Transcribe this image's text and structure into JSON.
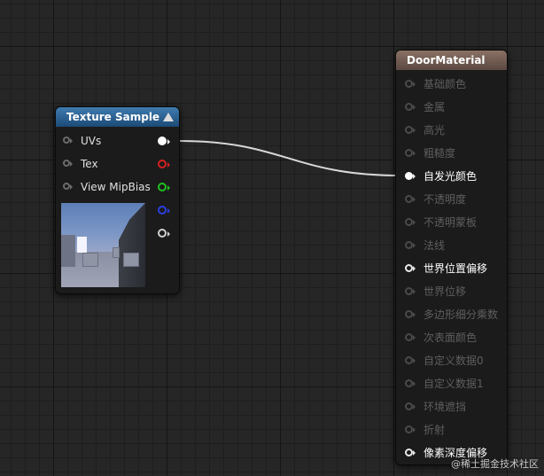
{
  "texture_node": {
    "title": "Texture Sample",
    "inputs": [
      {
        "label": "UVs"
      },
      {
        "label": "Tex"
      },
      {
        "label": "View MipBias"
      }
    ],
    "outputs": [
      {
        "color": "#ffffff",
        "connected": true
      },
      {
        "color": "#d42020"
      },
      {
        "color": "#20c020"
      },
      {
        "color": "#2a3fe0"
      },
      {
        "color": "#d0d0d0"
      }
    ]
  },
  "material_node": {
    "title": "DoorMaterial",
    "pins": [
      {
        "label": "基础颜色",
        "active": false
      },
      {
        "label": "金属",
        "active": false
      },
      {
        "label": "高光",
        "active": false
      },
      {
        "label": "粗糙度",
        "active": false
      },
      {
        "label": "自发光颜色",
        "active": true,
        "connected": true
      },
      {
        "label": "不透明度",
        "active": false
      },
      {
        "label": "不透明蒙板",
        "active": false
      },
      {
        "label": "法线",
        "active": false
      },
      {
        "label": "世界位置偏移",
        "active": true
      },
      {
        "label": "世界位移",
        "active": false
      },
      {
        "label": "多边形细分乘数",
        "active": false
      },
      {
        "label": "次表面颜色",
        "active": false
      },
      {
        "label": "自定义数据0",
        "active": false
      },
      {
        "label": "自定义数据1",
        "active": false
      },
      {
        "label": "环境遮挡",
        "active": false
      },
      {
        "label": "折射",
        "active": false
      },
      {
        "label": "像素深度偏移",
        "active": true
      }
    ]
  },
  "watermark": "@稀土掘金技术社区"
}
